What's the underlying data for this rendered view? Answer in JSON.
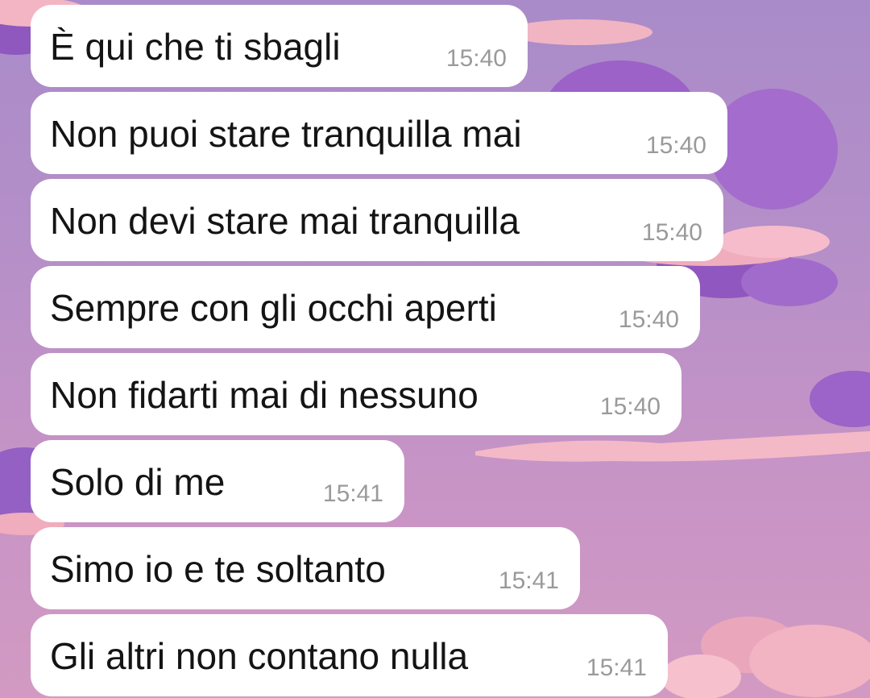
{
  "messages": [
    {
      "text": "È qui che ti sbagli",
      "time": "15:40"
    },
    {
      "text": "Non puoi stare tranquilla mai",
      "time": "15:40"
    },
    {
      "text": "Non devi stare mai tranquilla",
      "time": "15:40"
    },
    {
      "text": "Sempre con gli occhi aperti",
      "time": "15:40"
    },
    {
      "text": "Non fidarti mai di nessuno",
      "time": "15:40"
    },
    {
      "text": "Solo di me",
      "time": "15:41"
    },
    {
      "text": "Simo io e te soltanto",
      "time": "15:41"
    },
    {
      "text": "Gli altri non contano nulla",
      "time": "15:41"
    }
  ],
  "colors": {
    "bubble": "#ffffff",
    "text": "#141414",
    "time": "#9a9a9a",
    "wallpaper_purple": "#9b63c6",
    "wallpaper_pink": "#f2b0c0"
  }
}
